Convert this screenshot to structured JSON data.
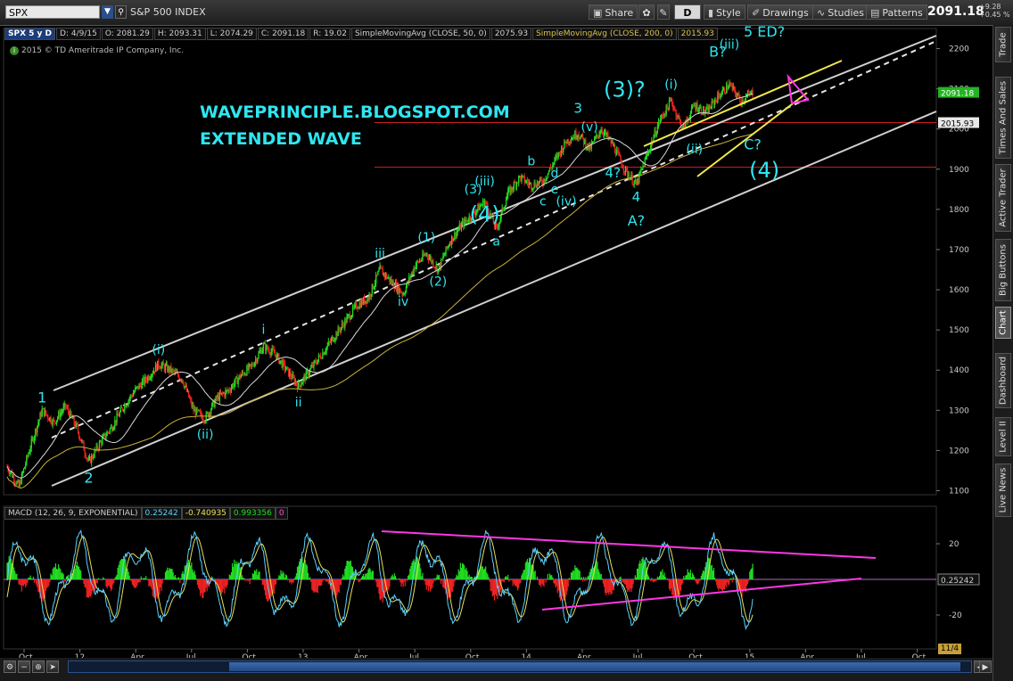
{
  "toolbar": {
    "symbol": "SPX",
    "symbol_name": "S&P 500 INDEX",
    "share_label": "Share",
    "period_label": "D",
    "style_label": "Style",
    "drawings_label": "Drawings",
    "studies_label": "Studies",
    "patterns_label": "Patterns",
    "last_price": "2091.18",
    "change_abs": "+9.28",
    "change_pct": "+0.45 %"
  },
  "info_bar": {
    "symbol_period": "SPX 5 y D",
    "date": "D: 4/9/15",
    "open": "O: 2081.29",
    "high": "H: 2093.31",
    "low": "L: 2074.29",
    "close": "C: 2091.18",
    "range": "R: 19.02",
    "sma50_label": "SimpleMovingAvg (CLOSE, 50, 0)",
    "sma50_value": "2075.93",
    "sma200_label": "SimpleMovingAvg (CLOSE, 200, 0)",
    "sma200_value": "2015.93"
  },
  "copyright": "2015 © TD Ameritrade IP Company, Inc.",
  "side_tabs": [
    "Trade",
    "Times And Sales",
    "Active Trader",
    "Big Buttons",
    "Chart",
    "Dashboard",
    "Level II",
    "Live News"
  ],
  "active_side_tab": "Chart",
  "colors": {
    "background": "#000000",
    "up_bar": "#22dd22",
    "down_bar": "#ee2222",
    "sma50": "#d8d8d8",
    "sma200": "#c9b13a",
    "wave_label": "#2ee6f0",
    "channel": "#d0d0d0",
    "wedge": "#f2e84a",
    "macd_line": "#5ad2ff",
    "signal_line": "#e8e05a",
    "macd_trend": "#ff36e8",
    "level_line": "#c81e1e",
    "hist_up": "#22dd22",
    "hist_down": "#ee2222"
  },
  "chart_data": [
    {
      "type": "candlestick",
      "title": "SPX 5 y D",
      "x_ticks": [
        "Oct",
        "12",
        "Apr",
        "Jul",
        "Oct",
        "13",
        "Apr",
        "Jul",
        "Oct",
        "14",
        "Apr",
        "Jul",
        "Oct",
        "15",
        "Apr",
        "Jul",
        "Oct"
      ],
      "y_ticks": [
        1100,
        1200,
        1300,
        1400,
        1500,
        1600,
        1700,
        1800,
        1900,
        2000,
        2100,
        2200
      ],
      "ylim": [
        1090,
        2250
      ],
      "price_marker": 2091.18,
      "sma_marker": 2015.93,
      "close_path": [
        [
          0,
          1160
        ],
        [
          1,
          1110
        ],
        [
          2,
          1210
        ],
        [
          3,
          1300
        ],
        [
          4,
          1270
        ],
        [
          5,
          1310
        ],
        [
          6,
          1255
        ],
        [
          7,
          1170
        ],
        [
          8,
          1220
        ],
        [
          9,
          1260
        ],
        [
          10,
          1310
        ],
        [
          11,
          1350
        ],
        [
          12,
          1380
        ],
        [
          13,
          1415
        ],
        [
          14,
          1400
        ],
        [
          15,
          1380
        ],
        [
          16,
          1300
        ],
        [
          17,
          1280
        ],
        [
          18,
          1330
        ],
        [
          19,
          1350
        ],
        [
          20,
          1385
        ],
        [
          21,
          1410
        ],
        [
          22,
          1460
        ],
        [
          23,
          1440
        ],
        [
          24,
          1400
        ],
        [
          25,
          1360
        ],
        [
          26,
          1400
        ],
        [
          27,
          1440
        ],
        [
          28,
          1480
        ],
        [
          29,
          1520
        ],
        [
          30,
          1560
        ],
        [
          31,
          1580
        ],
        [
          32,
          1650
        ],
        [
          33,
          1620
        ],
        [
          34,
          1590
        ],
        [
          35,
          1660
        ],
        [
          36,
          1690
        ],
        [
          37,
          1650
        ],
        [
          38,
          1720
        ],
        [
          39,
          1760
        ],
        [
          40,
          1790
        ],
        [
          41,
          1820
        ],
        [
          42,
          1750
        ],
        [
          43,
          1840
        ],
        [
          44,
          1880
        ],
        [
          45,
          1860
        ],
        [
          46,
          1870
        ],
        [
          47,
          1920
        ],
        [
          48,
          1970
        ],
        [
          49,
          1990
        ],
        [
          50,
          1950
        ],
        [
          51,
          2000
        ],
        [
          52,
          1960
        ],
        [
          53,
          1900
        ],
        [
          54,
          1860
        ],
        [
          55,
          1940
        ],
        [
          56,
          2020
        ],
        [
          57,
          2070
        ],
        [
          58,
          2000
        ],
        [
          59,
          2060
        ],
        [
          60,
          2040
        ],
        [
          61,
          2080
        ],
        [
          62,
          2110
        ],
        [
          63,
          2070
        ],
        [
          64,
          2091
        ]
      ],
      "wave_labels": [
        {
          "text": "1",
          "pos": [
            3,
            1320
          ]
        },
        {
          "text": "2",
          "pos": [
            7,
            1120
          ]
        },
        {
          "text": "(i)",
          "pos": [
            13,
            1440
          ]
        },
        {
          "text": "(ii)",
          "pos": [
            17,
            1230
          ]
        },
        {
          "text": "i",
          "pos": [
            22,
            1490
          ]
        },
        {
          "text": "ii",
          "pos": [
            25,
            1310
          ]
        },
        {
          "text": "iii",
          "pos": [
            32,
            1680
          ]
        },
        {
          "text": "iv",
          "pos": [
            34,
            1560
          ]
        },
        {
          "text": "(1)",
          "pos": [
            36,
            1720
          ]
        },
        {
          "text": "(2)",
          "pos": [
            37,
            1610
          ]
        },
        {
          "text": "(3)",
          "pos": [
            40,
            1840
          ]
        },
        {
          "text": "(4)",
          "pos": [
            41,
            1770
          ]
        },
        {
          "text": "(iii)",
          "pos": [
            41,
            1860
          ]
        },
        {
          "text": "a",
          "pos": [
            42,
            1710
          ]
        },
        {
          "text": "b",
          "pos": [
            45,
            1910
          ]
        },
        {
          "text": "c",
          "pos": [
            46,
            1810
          ]
        },
        {
          "text": "d",
          "pos": [
            47,
            1880
          ]
        },
        {
          "text": "e",
          "pos": [
            47,
            1840
          ]
        },
        {
          "text": "(iv)",
          "pos": [
            48,
            1810
          ]
        },
        {
          "text": "3",
          "pos": [
            49,
            2040
          ]
        },
        {
          "text": "(v)",
          "pos": [
            50,
            1995
          ]
        },
        {
          "text": "4?",
          "pos": [
            52,
            1880
          ]
        },
        {
          "text": "(3)?",
          "pos": [
            53,
            2080
          ]
        },
        {
          "text": "4",
          "pos": [
            54,
            1820
          ]
        },
        {
          "text": "A?",
          "pos": [
            54,
            1760
          ]
        },
        {
          "text": "(i)",
          "pos": [
            57,
            2100
          ]
        },
        {
          "text": "(ii)",
          "pos": [
            59,
            1940
          ]
        },
        {
          "text": "B?",
          "pos": [
            61,
            2180
          ]
        },
        {
          "text": "(iii)",
          "pos": [
            62,
            2200
          ]
        },
        {
          "text": "5 ED?",
          "pos": [
            65,
            2230
          ]
        },
        {
          "text": "C?",
          "pos": [
            64,
            1950
          ]
        },
        {
          "text": "(4)",
          "pos": [
            65,
            1880
          ]
        }
      ],
      "annotations": [
        "WAVEPRINCIPLE.BLOGSPOT.COM",
        "EXTENDED WAVE"
      ]
    },
    {
      "type": "line",
      "title": "MACD (12, 26, 9, EXPONENTIAL)",
      "legend": [
        "MACD (12, 26, 9, EXPONENTIAL)",
        "0.25242",
        "-0.740935",
        "0.993356",
        "0"
      ],
      "y_ticks": [
        20,
        -20
      ],
      "ylim": [
        -35,
        35
      ],
      "current_value": "0.25242"
    }
  ],
  "bottom_controls": {
    "date_box": "11/4"
  }
}
